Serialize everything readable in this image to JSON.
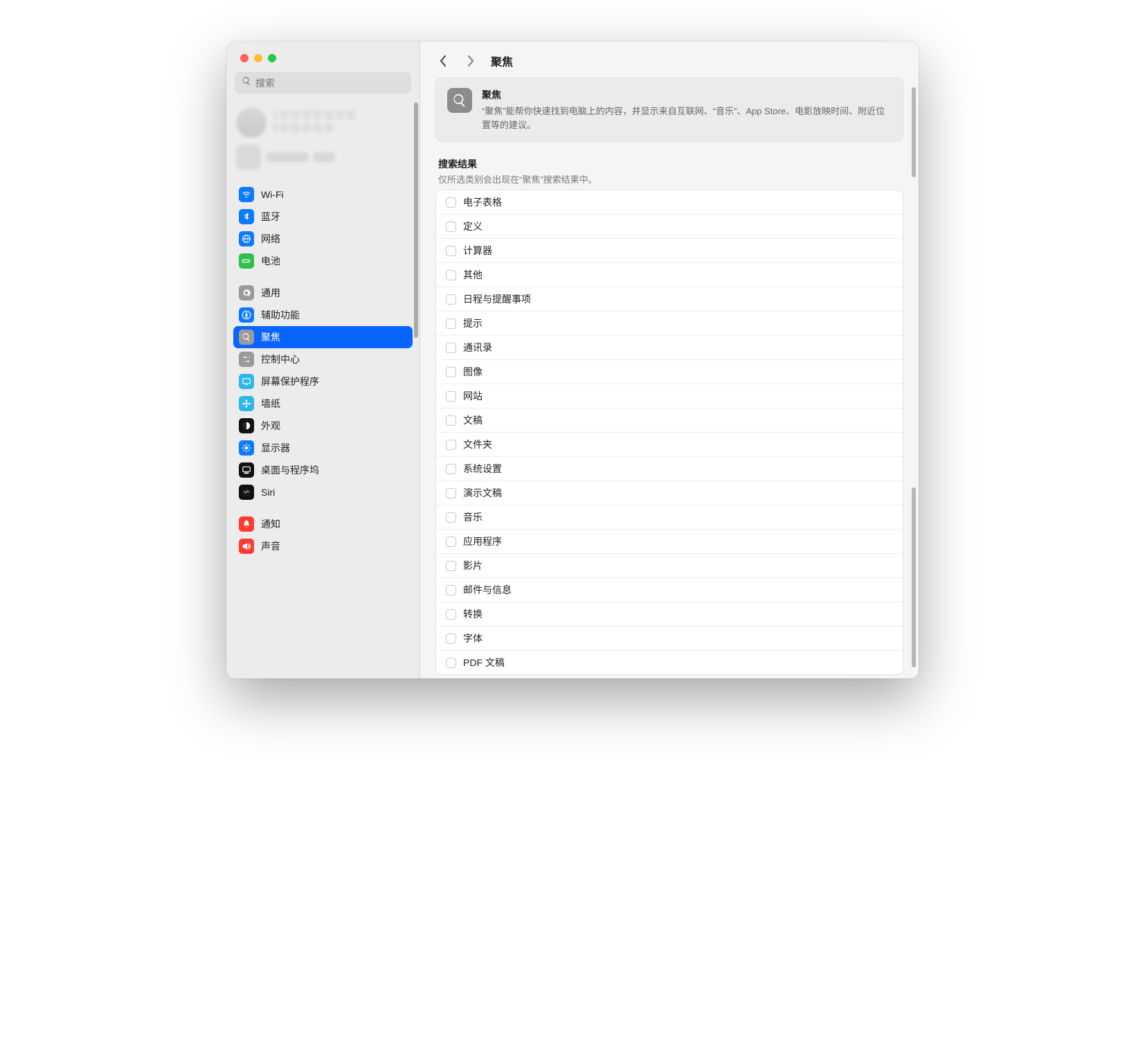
{
  "search": {
    "placeholder": "搜索"
  },
  "sidebar": {
    "groups": [
      {
        "items": [
          {
            "id": "wifi",
            "label": "Wi-Fi",
            "icon": "wifi",
            "bg": "#0a7bff"
          },
          {
            "id": "bluetooth",
            "label": "蓝牙",
            "icon": "bluetooth",
            "bg": "#0a7bff"
          },
          {
            "id": "network",
            "label": "网络",
            "icon": "globe",
            "bg": "#0a7bff"
          },
          {
            "id": "battery",
            "label": "电池",
            "icon": "battery",
            "bg": "#2fbf4a"
          }
        ]
      },
      {
        "items": [
          {
            "id": "general",
            "label": "通用",
            "icon": "gear",
            "bg": "#9a9a9a"
          },
          {
            "id": "accessibility",
            "label": "辅助功能",
            "icon": "accessibility",
            "bg": "#0a7bff"
          },
          {
            "id": "spotlight",
            "label": "聚焦",
            "icon": "search",
            "bg": "#9a9a9a",
            "selected": true
          },
          {
            "id": "control-center",
            "label": "控制中心",
            "icon": "sliders",
            "bg": "#9a9a9a"
          },
          {
            "id": "screensaver",
            "label": "屏幕保护程序",
            "icon": "screensaver",
            "bg": "#2bb7e8"
          },
          {
            "id": "wallpaper",
            "label": "墙纸",
            "icon": "flower",
            "bg": "#2bb7e8"
          },
          {
            "id": "appearance",
            "label": "外观",
            "icon": "appearance",
            "bg": "#111"
          },
          {
            "id": "displays",
            "label": "显示器",
            "icon": "sun",
            "bg": "#0a7bff"
          },
          {
            "id": "dock",
            "label": "桌面与程序坞",
            "icon": "dock",
            "bg": "#111"
          },
          {
            "id": "siri",
            "label": "Siri",
            "icon": "siri",
            "bg": "#111"
          }
        ]
      },
      {
        "items": [
          {
            "id": "notifications",
            "label": "通知",
            "icon": "bell",
            "bg": "#ff3b30"
          },
          {
            "id": "sound",
            "label": "声音",
            "icon": "speaker",
            "bg": "#ff3b30"
          }
        ]
      }
    ]
  },
  "header": {
    "title": "聚焦"
  },
  "hero": {
    "title": "聚焦",
    "desc": "“聚焦”能帮你快速找到电脑上的内容，并显示来自互联网、“音乐”、App Store、电影放映时间、附近位置等的建议。"
  },
  "section": {
    "title": "搜索结果",
    "subtitle": "仅所选类别会出现在“聚焦”搜索结果中。"
  },
  "results": [
    "电子表格",
    "定义",
    "计算器",
    "其他",
    "日程与提醒事项",
    "提示",
    "通讯录",
    "图像",
    "网站",
    "文稿",
    "文件夹",
    "系统设置",
    "演示文稿",
    "音乐",
    "应用程序",
    "影片",
    "邮件与信息",
    "转换",
    "字体",
    "PDF 文稿"
  ]
}
